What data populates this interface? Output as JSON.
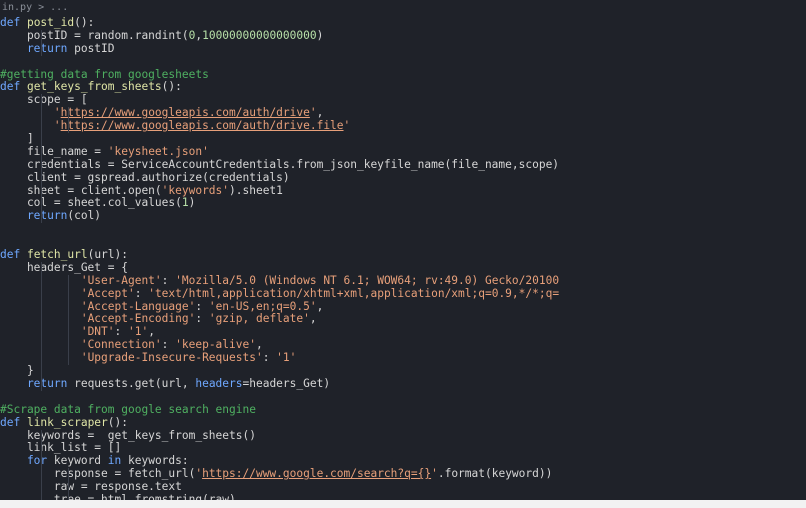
{
  "breadcrumb": "in.py > ...",
  "lines": [
    [
      [
        "kw",
        "def "
      ],
      [
        "fn",
        "post_id"
      ],
      [
        "op",
        "():"
      ]
    ],
    [
      [
        "op",
        "    postID = random.randint("
      ],
      [
        "num",
        "0"
      ],
      [
        "op",
        ","
      ],
      [
        "num",
        "10000000000000000"
      ],
      [
        "op",
        ")"
      ]
    ],
    [
      [
        "kw",
        "    return "
      ],
      [
        "op",
        "postID"
      ]
    ],
    [
      [
        "op",
        ""
      ]
    ],
    [
      [
        "com",
        "#getting data from googlesheets"
      ]
    ],
    [
      [
        "kw",
        "def "
      ],
      [
        "fn",
        "get_keys_from_sheets"
      ],
      [
        "op",
        "():"
      ]
    ],
    [
      [
        "op",
        "    scope = ["
      ]
    ],
    [
      [
        "op",
        "        "
      ],
      [
        "str",
        "'"
      ],
      [
        "url",
        "https://www.googleapis.com/auth/drive"
      ],
      [
        "str",
        "'"
      ],
      [
        "op",
        ","
      ]
    ],
    [
      [
        "op",
        "        "
      ],
      [
        "str",
        "'"
      ],
      [
        "url",
        "https://www.googleapis.com/auth/drive.file"
      ],
      [
        "str",
        "'"
      ]
    ],
    [
      [
        "op",
        "    ]"
      ]
    ],
    [
      [
        "op",
        "    file_name = "
      ],
      [
        "str",
        "'keysheet.json'"
      ]
    ],
    [
      [
        "op",
        "    credentials = ServiceAccountCredentials.from_json_keyfile_name(file_name,scope)"
      ]
    ],
    [
      [
        "op",
        "    client = gspread.authorize(credentials)"
      ]
    ],
    [
      [
        "op",
        "    sheet = client.open("
      ],
      [
        "str",
        "'keywords'"
      ],
      [
        "op",
        ").sheet1"
      ]
    ],
    [
      [
        "op",
        "    col = sheet.col_values("
      ],
      [
        "num",
        "1"
      ],
      [
        "op",
        ")"
      ]
    ],
    [
      [
        "kw",
        "    return"
      ],
      [
        "op",
        "(col)"
      ]
    ],
    [
      [
        "op",
        ""
      ]
    ],
    [
      [
        "op",
        ""
      ]
    ],
    [
      [
        "kw",
        "def "
      ],
      [
        "fn",
        "fetch_url"
      ],
      [
        "op",
        "(url):"
      ]
    ],
    [
      [
        "op",
        "    headers_Get = {"
      ]
    ],
    [
      [
        "op",
        "            "
      ],
      [
        "str",
        "'User-Agent'"
      ],
      [
        "op",
        ": "
      ],
      [
        "str",
        "'Mozilla/5.0 (Windows NT 6.1; WOW64; rv:49.0) Gecko/20100"
      ]
    ],
    [
      [
        "op",
        "            "
      ],
      [
        "str",
        "'Accept'"
      ],
      [
        "op",
        ": "
      ],
      [
        "str",
        "'text/html,application/xhtml+xml,application/xml;q=0.9,*/*;q="
      ]
    ],
    [
      [
        "op",
        "            "
      ],
      [
        "str",
        "'Accept-Language'"
      ],
      [
        "op",
        ": "
      ],
      [
        "str",
        "'en-US,en;q=0.5'"
      ],
      [
        "op",
        ","
      ]
    ],
    [
      [
        "op",
        "            "
      ],
      [
        "str",
        "'Accept-Encoding'"
      ],
      [
        "op",
        ": "
      ],
      [
        "str",
        "'gzip, deflate'"
      ],
      [
        "op",
        ","
      ]
    ],
    [
      [
        "op",
        "            "
      ],
      [
        "str",
        "'DNT'"
      ],
      [
        "op",
        ": "
      ],
      [
        "str",
        "'1'"
      ],
      [
        "op",
        ","
      ]
    ],
    [
      [
        "op",
        "            "
      ],
      [
        "str",
        "'Connection'"
      ],
      [
        "op",
        ": "
      ],
      [
        "str",
        "'keep-alive'"
      ],
      [
        "op",
        ","
      ]
    ],
    [
      [
        "op",
        "            "
      ],
      [
        "str",
        "'Upgrade-Insecure-Requests'"
      ],
      [
        "op",
        ": "
      ],
      [
        "str",
        "'1'"
      ]
    ],
    [
      [
        "op",
        "    }"
      ]
    ],
    [
      [
        "kw",
        "    return "
      ],
      [
        "op",
        "requests.get(url, "
      ],
      [
        "kw",
        "headers"
      ],
      [
        "op",
        "=headers_Get)"
      ]
    ],
    [
      [
        "op",
        ""
      ]
    ],
    [
      [
        "com",
        "#Scrape data from google search engine"
      ]
    ],
    [
      [
        "kw",
        "def "
      ],
      [
        "fn",
        "link_scraper"
      ],
      [
        "op",
        "():"
      ]
    ],
    [
      [
        "op",
        "    keywords =  get_keys_from_sheets()"
      ]
    ],
    [
      [
        "op",
        "    link_list = []"
      ]
    ],
    [
      [
        "kw",
        "    for "
      ],
      [
        "op",
        "keyword "
      ],
      [
        "kw",
        "in "
      ],
      [
        "op",
        "keywords:"
      ]
    ],
    [
      [
        "op",
        "        response = fetch_url("
      ],
      [
        "str",
        "'"
      ],
      [
        "url",
        "https://www.google.com/search?q={}"
      ],
      [
        "str",
        "'"
      ],
      [
        "op",
        ".format(keyword))"
      ]
    ],
    [
      [
        "op",
        "        raw = response.text"
      ]
    ],
    [
      [
        "op",
        "        tree = html.fromstring(raw)"
      ]
    ]
  ],
  "colors": {
    "background": "#1f2229",
    "keyword": "#6fa8ff",
    "function": "#dfe5a6",
    "string": "#e8a07a",
    "comment": "#4fb061",
    "number": "#b7e0a8",
    "text": "#d6d6d6"
  }
}
